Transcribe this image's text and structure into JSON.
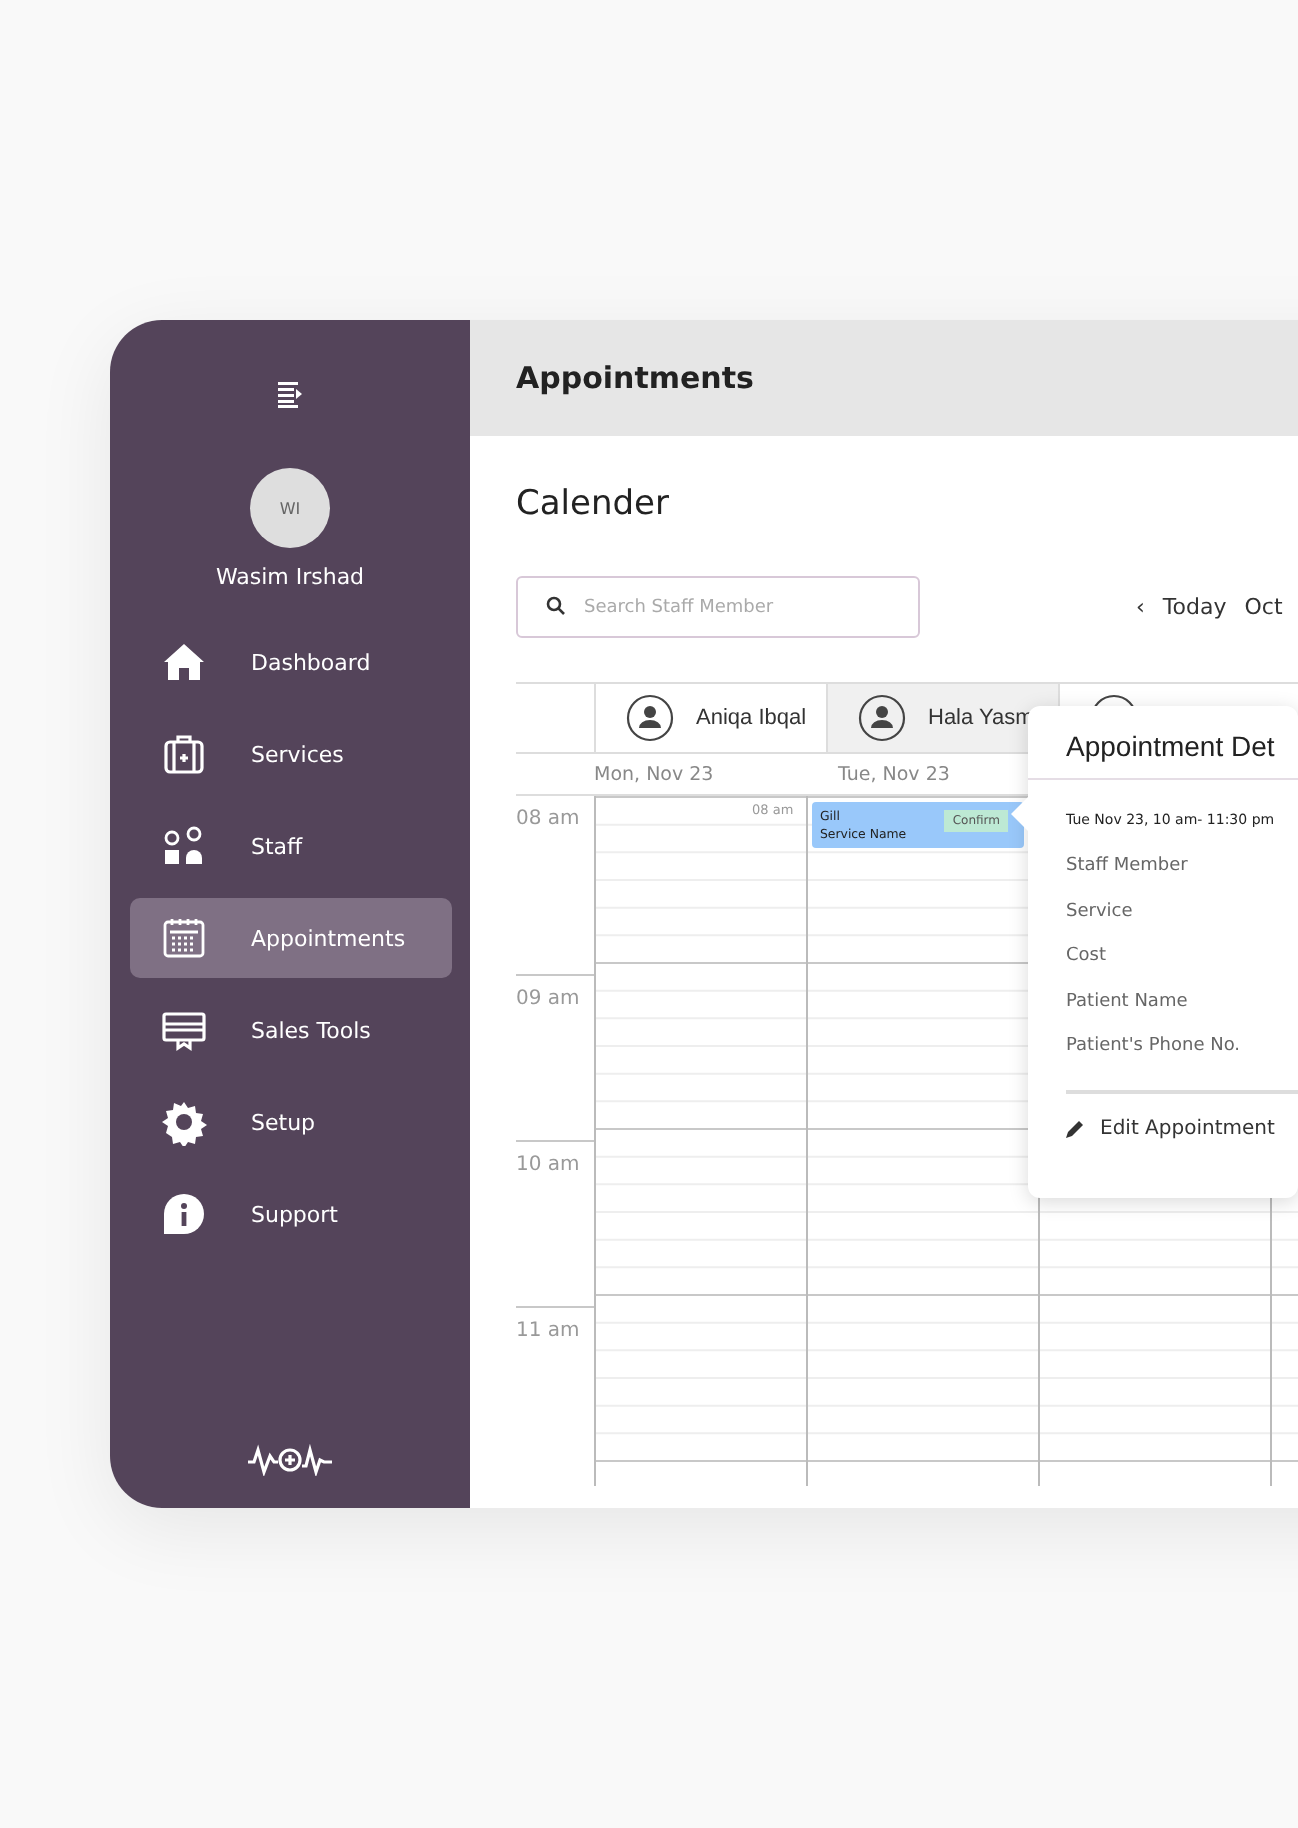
{
  "sidebar": {
    "user": {
      "initials": "WI",
      "name": "Wasim Irshad"
    },
    "items": [
      {
        "label": "Dashboard",
        "selected": false
      },
      {
        "label": "Services",
        "selected": false
      },
      {
        "label": "Staff",
        "selected": false
      },
      {
        "label": "Appointments",
        "selected": true
      },
      {
        "label": "Sales Tools",
        "selected": false
      },
      {
        "label": "Setup",
        "selected": false
      },
      {
        "label": "Support",
        "selected": false
      }
    ]
  },
  "header": {
    "title": "Appointments"
  },
  "calendar": {
    "title": "Calender",
    "search": {
      "placeholder": "Search Staff Member"
    },
    "nav": {
      "prev": "‹",
      "today": "Today",
      "month": "Oct"
    },
    "staff": [
      {
        "name": "Aniqa Ibqal"
      },
      {
        "name": "Hala Yasm"
      }
    ],
    "days": [
      "Mon, Nov 23",
      "Tue, Nov 23"
    ],
    "hours": [
      "08 am",
      "09 am",
      "10 am",
      "11 am"
    ],
    "slot_label": "08 am",
    "event": {
      "title": "Gill",
      "service": "Service Name",
      "status": "Confirm"
    }
  },
  "popup": {
    "title": "Appointment Det",
    "time": "Tue Nov 23, 10 am- 11:30 pm",
    "fields": [
      "Staff Member",
      "Service",
      "Cost",
      "Patient Name",
      "Patient's Phone No."
    ],
    "action": "Edit Appointment"
  }
}
